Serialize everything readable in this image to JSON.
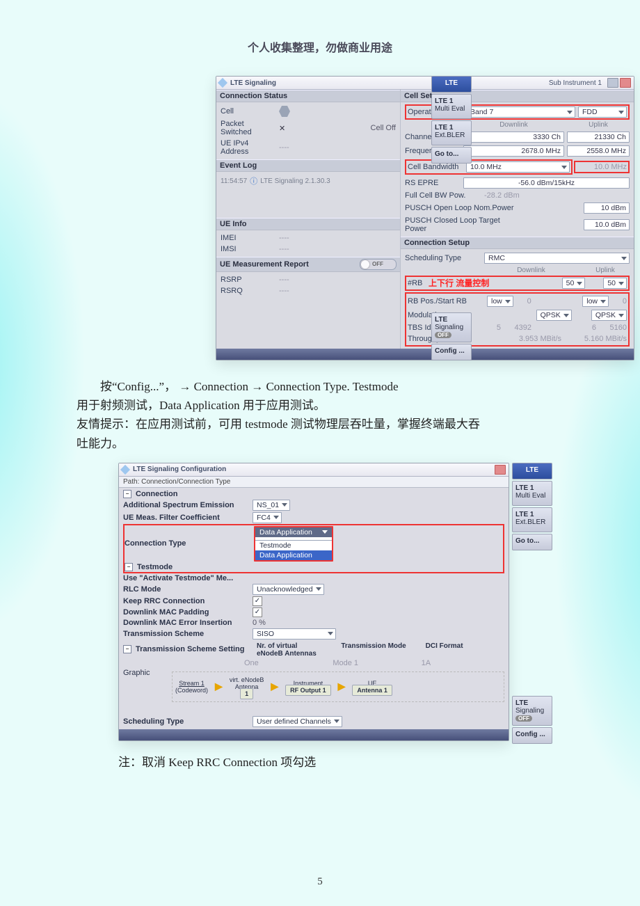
{
  "page_header": "个人收集整理，勿做商业用途",
  "page_number": "5",
  "body_text": {
    "p1_a": "按“Config...”，  →  Connection  →  Connection  Type.   Testmode",
    "p1_b": "用于射频测试，Data  Application 用于应用测试。",
    "p1_c": "友情提示：在应用测试前，可用 testmode 测试物理层吞吐量，掌握终端最大吞",
    "p1_d": "吐能力。",
    "note": "注：取消 Keep RRC Connection 项勾选"
  },
  "side_tabs": {
    "lte": "LTE",
    "t1a": "LTE 1",
    "t1b": "Multi Eval",
    "t2a": "LTE 1",
    "t2b": "Ext.BLER",
    "goto": "Go to...",
    "siga": "LTE",
    "sigb": "Signaling",
    "off": "OFF",
    "config": "Config ..."
  },
  "s1": {
    "title": "LTE Signaling",
    "sub_instrument": "Sub Instrument 1",
    "conn_status_hdr": "Connection Status",
    "cell_label": "Cell",
    "packet_switched_label": "Packet Switched",
    "packet_switched_value": "Cell Off",
    "ue_ipv4_label": "UE IPv4 Address",
    "ue_ipv4_value": "----",
    "event_log_hdr": "Event Log",
    "event_time": "11:54:57",
    "event_msg": "LTE Signaling 2.1.30.3",
    "ue_info_hdr": "UE Info",
    "imei_label": "IMEI",
    "imei_value": "----",
    "imsi_label": "IMSI",
    "imsi_value": "----",
    "ue_meas_hdr": "UE Measurement Report",
    "rsrp_label": "RSRP",
    "rsrq_label": "RSRQ",
    "meas_value": "----",
    "off_badge": "OFF",
    "cell_setup_hdr": "Cell Setup",
    "op_band_label": "Operating Band",
    "op_band_value": "Band 7",
    "duplex_value": "FDD",
    "downlink_hdr": "Downlink",
    "uplink_hdr": "Uplink",
    "channel_label": "Channel",
    "channel_dl": "3330  Ch",
    "channel_ul": "21330  Ch",
    "freq_label": "Frequency",
    "freq_dl": "2678.0  MHz",
    "freq_ul": "2558.0  MHz",
    "cell_bw_label": "Cell Bandwidth",
    "cell_bw_dl": "10.0  MHz",
    "cell_bw_ul": "10.0  MHz",
    "rsepre_label": "RS EPRE",
    "rsepre_value": "-56.0  dBm/15kHz",
    "full_cell_bw_label": "Full Cell BW Pow.",
    "full_cell_bw_value": "-28.2  dBm",
    "pusch_open_label": "PUSCH Open Loop Nom.Power",
    "pusch_open_value": "10  dBm",
    "pusch_closed_label": "PUSCH Closed Loop Target Power",
    "pusch_closed_value": "10.0  dBm",
    "conn_setup_hdr": "Connection Setup",
    "sched_type_label": "Scheduling Type",
    "sched_type_value": "RMC",
    "rb_label": "#RB",
    "rb_annot": "上下行 流量控制",
    "rb_dl": "50",
    "rb_ul": "50",
    "rbpos_label": "RB Pos./Start RB",
    "rbpos_dl": "low",
    "rbpos_dl_n": "0",
    "rbpos_ul": "low",
    "rbpos_ul_n": "0",
    "mod_label": "Modulation",
    "mod_dl": "QPSK",
    "mod_ul": "QPSK",
    "tbs_label": "TBS Idx / Value",
    "tbs_a": "5",
    "tbs_b": "4392",
    "tbs_c": "6",
    "tbs_d": "5160",
    "thr_label": "Throughput",
    "thr_dl": "3.953  MBit/s",
    "thr_ul": "5.160  MBit/s"
  },
  "s2": {
    "title": "LTE Signaling Configuration",
    "path": "Path:  Connection/Connection Type",
    "n_connection": "Connection",
    "n_ase": "Additional Spectrum Emission",
    "v_ase": "NS_01",
    "n_uefc": "UE Meas. Filter Coefficient",
    "v_uefc": "FC4",
    "n_conntype": "Connection Type",
    "v_conntype": "Data Application",
    "n_testmode": "Testmode",
    "v_testmode": "Testmode",
    "dd_dataapp": "Data Application",
    "n_useact": "Use \"Activate Testmode\" Me...",
    "n_rlc": "RLC Mode",
    "v_rlc": "Unacknowledged",
    "n_keeprrc": "Keep RRC Connection",
    "n_dlpad": "Downlink MAC Padding",
    "n_dlerr": "Downlink MAC Error Insertion",
    "v_dlerr": "0 %",
    "n_tscheme": "Transmission Scheme",
    "v_tscheme": "SISO",
    "n_tsset": "Transmission Scheme Setting",
    "th1": "Nr. of virtual\neNodeB Antennas",
    "th2": "Transmission Mode",
    "th3": "DCI Format",
    "tv1": "One",
    "tv2": "Mode 1",
    "tv3": "1A",
    "n_graphic": "Graphic",
    "g_vea": "virt. eNodeB\nAntenna",
    "g_instr": "Instrument",
    "g_ue": "UE",
    "g_stream": "Stream 1",
    "g_codeword": "(Codeword)",
    "g_one": "1",
    "g_rf": "RF Output 1",
    "g_ant": "Antenna 1",
    "n_sched": "Scheduling Type",
    "v_sched": "User defined Channels"
  }
}
